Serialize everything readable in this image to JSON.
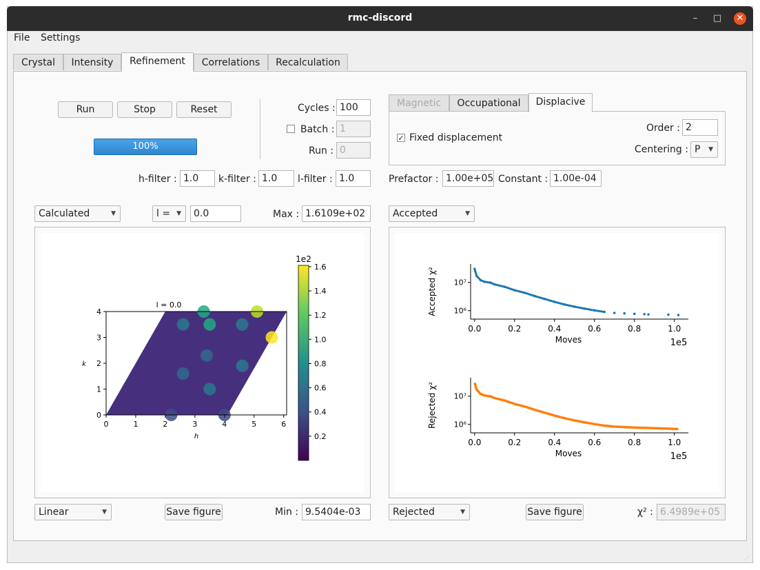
{
  "window": {
    "title": "rmc-discord",
    "minimize": "–",
    "maximize": "□",
    "close": "✕"
  },
  "menu": [
    "File",
    "Settings"
  ],
  "tabs": [
    "Crystal",
    "Intensity",
    "Refinement",
    "Correlations",
    "Recalculation"
  ],
  "active_tab": "Refinement",
  "controls": {
    "run": "Run",
    "stop": "Stop",
    "reset": "Reset",
    "progress_text": "100%",
    "progress": 1.0,
    "cycles_label": "Cycles :",
    "cycles_value": "100",
    "batch_label": "Batch :",
    "batch_value": "1",
    "run_label": "Run :",
    "run_value": "0",
    "h_filter_label": "h-filter :",
    "h_filter_value": "1.0",
    "k_filter_label": "k-filter :",
    "k_filter_value": "1.0",
    "l_filter_label": "l-filter :",
    "l_filter_value": "1.0"
  },
  "subtabs": [
    "Magnetic",
    "Occupational",
    "Displacive"
  ],
  "active_subtab": "Displacive",
  "displacive": {
    "fixed_label": "Fixed displacement",
    "fixed_checked": true,
    "order_label": "Order :",
    "order_value": "2",
    "centering_label": "Centering :",
    "centering_value": "P",
    "prefactor_label": "Prefactor :",
    "prefactor_value": "1.00e+05",
    "constant_label": "Constant :",
    "constant_value": "1.00e-04"
  },
  "left_panel": {
    "dataset_select": "Calculated",
    "slice_select": "l =",
    "slice_value": "0.0",
    "max_label": "Max :",
    "max_value": "1.6109e+02",
    "scale_select": "Linear",
    "save_button": "Save figure",
    "min_label": "Min :",
    "min_value": "9.5404e-03"
  },
  "right_panel": {
    "top_select": "Accepted",
    "bottom_select": "Rejected",
    "save_button": "Save figure",
    "chi2_label": "χ² :",
    "chi2_value": "6.4989e+05"
  },
  "chart_data": [
    {
      "type": "heatmap",
      "title": "l = 0.0",
      "xlabel": "h",
      "ylabel": "k",
      "xticks": [
        "0",
        "1",
        "2",
        "3",
        "4",
        "5",
        "6"
      ],
      "yticks": [
        "0",
        "1",
        "2",
        "3",
        "4"
      ],
      "xlim": [
        0,
        6.1
      ],
      "ylim": [
        0,
        4
      ],
      "colorbar": {
        "multiplier": "1e2",
        "ticks": [
          "0.2",
          "0.4",
          "0.6",
          "0.8",
          "1.0",
          "1.2",
          "1.4",
          "1.6"
        ],
        "range": [
          9.54e-05,
          1.6109
        ],
        "colormap": [
          "#440154",
          "#3b528b",
          "#21918c",
          "#5ec962",
          "#fde725"
        ]
      }
    },
    {
      "type": "scatter",
      "ylabel": "Accepted χ²",
      "xlabel": "Moves",
      "x_multiplier": "1e5",
      "xticks": [
        "0.0",
        "0.2",
        "0.4",
        "0.6",
        "0.8",
        "1.0"
      ],
      "yticks": [
        "10⁷",
        "10⁶"
      ],
      "xlim": [
        -0.02,
        1.07
      ],
      "log_y": true,
      "color": "#1f77b4",
      "x": [
        0.0,
        0.01,
        0.03,
        0.05,
        0.08,
        0.1,
        0.15,
        0.2,
        0.25,
        0.3,
        0.35,
        0.4,
        0.45,
        0.5,
        0.55,
        0.6,
        0.65,
        0.7,
        0.75,
        0.8,
        0.85,
        0.87,
        0.97,
        1.02
      ],
      "y": [
        30000000,
        17000000,
        12000000,
        10500000,
        9800000,
        8500000,
        7000000,
        5300000,
        4300000,
        3300000,
        2600000,
        2050000,
        1650000,
        1380000,
        1180000,
        1020000,
        900000,
        830000,
        800000,
        770000,
        750000,
        730000,
        720000,
        700000
      ]
    },
    {
      "type": "line",
      "ylabel": "Rejected χ²",
      "xlabel": "Moves",
      "x_multiplier": "1e5",
      "xticks": [
        "0.0",
        "0.2",
        "0.4",
        "0.6",
        "0.8",
        "1.0"
      ],
      "yticks": [
        "10⁷",
        "10⁶"
      ],
      "xlim": [
        -0.02,
        1.07
      ],
      "log_y": true,
      "color": "#ff7f0e",
      "x": [
        0.0,
        0.01,
        0.03,
        0.05,
        0.08,
        0.1,
        0.15,
        0.2,
        0.25,
        0.3,
        0.35,
        0.4,
        0.45,
        0.5,
        0.55,
        0.6,
        0.65,
        0.7,
        0.75,
        0.8,
        0.85,
        0.9,
        0.95,
        1.0,
        1.02
      ],
      "y": [
        30000000,
        17000000,
        12000000,
        10500000,
        9800000,
        8500000,
        7000000,
        5300000,
        4300000,
        3300000,
        2600000,
        2050000,
        1650000,
        1380000,
        1180000,
        1020000,
        900000,
        830000,
        800000,
        770000,
        750000,
        730000,
        710000,
        690000,
        680000
      ]
    }
  ]
}
